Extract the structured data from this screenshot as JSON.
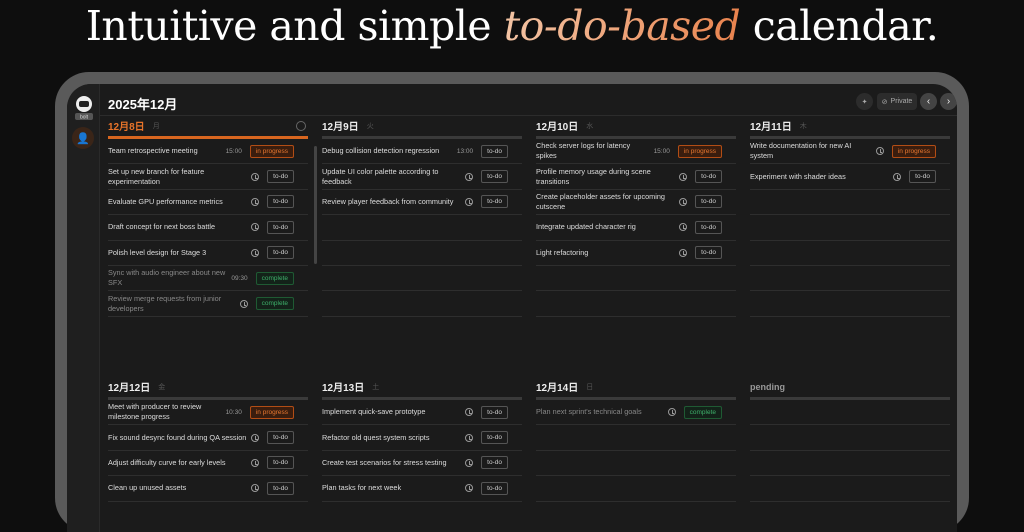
{
  "hero": {
    "pre": "Intuitive and simple ",
    "em": "to-do-based",
    "post": " calendar."
  },
  "app": {
    "logo_text": "bolt",
    "month": "2025年12月",
    "private_label": "Private"
  },
  "colors": {
    "accent": "#e8742a",
    "complete": "#3eb06a"
  },
  "days": [
    {
      "date": "12月8日",
      "weekday": "月",
      "today": true,
      "tasks": [
        {
          "title": "Team retrospective meeting",
          "time": "15:00",
          "status": "in progress"
        },
        {
          "title": "Set up new branch for feature experimentation",
          "time": "",
          "status": "to-do"
        },
        {
          "title": "Evaluate GPU performance metrics",
          "time": "",
          "status": "to-do"
        },
        {
          "title": "Draft concept for next boss battle",
          "time": "",
          "status": "to-do"
        },
        {
          "title": "Polish level design for Stage 3",
          "time": "",
          "status": "to-do"
        },
        {
          "title": "Sync with audio engineer about new SFX",
          "time": "09:30",
          "status": "complete"
        },
        {
          "title": "Review merge requests from junior developers",
          "time": "",
          "status": "complete"
        }
      ]
    },
    {
      "date": "12月9日",
      "weekday": "火",
      "tasks": [
        {
          "title": "Debug collision detection regression",
          "time": "13:00",
          "status": "to-do"
        },
        {
          "title": "Update UI color palette according to feedback",
          "time": "",
          "status": "to-do"
        },
        {
          "title": "Review player feedback from community",
          "time": "",
          "status": "to-do"
        }
      ]
    },
    {
      "date": "12月10日",
      "weekday": "水",
      "tasks": [
        {
          "title": "Check server logs for latency spikes",
          "time": "15:00",
          "status": "in progress"
        },
        {
          "title": "Profile memory usage during scene transitions",
          "time": "",
          "status": "to-do"
        },
        {
          "title": "Create placeholder assets for upcoming cutscene",
          "time": "",
          "status": "to-do"
        },
        {
          "title": "Integrate updated character rig",
          "time": "",
          "status": "to-do"
        },
        {
          "title": "Light refactoring",
          "time": "",
          "status": "to-do"
        }
      ]
    },
    {
      "date": "12月11日",
      "weekday": "木",
      "tasks": [
        {
          "title": "Write documentation for new AI system",
          "time": "",
          "status": "in progress"
        },
        {
          "title": "Experiment with shader ideas",
          "time": "",
          "status": "to-do"
        }
      ]
    },
    {
      "date": "12月12日",
      "weekday": "金",
      "tasks": [
        {
          "title": "Meet with producer to review milestone progress",
          "time": "10:30",
          "status": "in progress"
        },
        {
          "title": "Fix sound desync found during QA session",
          "time": "",
          "status": "to-do"
        },
        {
          "title": "Adjust difficulty curve for early levels",
          "time": "",
          "status": "to-do"
        },
        {
          "title": "Clean up unused assets",
          "time": "",
          "status": "to-do"
        }
      ]
    },
    {
      "date": "12月13日",
      "weekday": "土",
      "tasks": [
        {
          "title": "Implement quick-save prototype",
          "time": "",
          "status": "to-do"
        },
        {
          "title": "Refactor old quest system scripts",
          "time": "",
          "status": "to-do"
        },
        {
          "title": "Create test scenarios for stress testing",
          "time": "",
          "status": "to-do"
        },
        {
          "title": "Plan tasks for next week",
          "time": "",
          "status": "to-do"
        }
      ]
    },
    {
      "date": "12月14日",
      "weekday": "日",
      "tasks": [
        {
          "title": "Plan next sprint's technical goals",
          "time": "",
          "status": "complete"
        }
      ]
    },
    {
      "date": "pending",
      "weekday": "",
      "pending": true,
      "tasks": []
    }
  ]
}
